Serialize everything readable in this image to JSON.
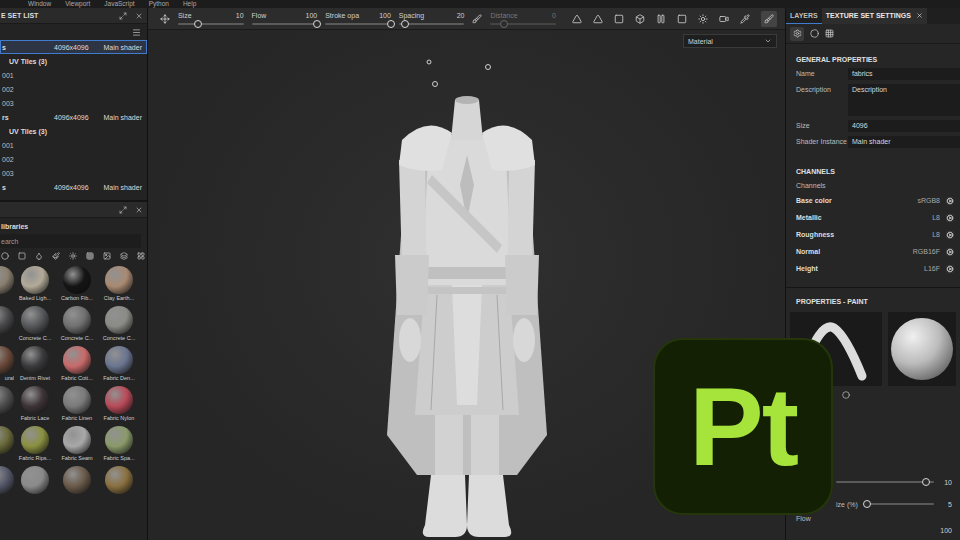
{
  "menu": [
    "Window",
    "Viewport",
    "JavaScript",
    "Python",
    "Help"
  ],
  "toolbar": {
    "sliders": [
      {
        "label": "Size",
        "value": "10",
        "level": 0.3,
        "disabled": false
      },
      {
        "label": "Flow",
        "value": "100",
        "level": 1,
        "disabled": false
      },
      {
        "label": "Stroke opa",
        "value": "100",
        "level": 1,
        "disabled": false
      },
      {
        "label": "Spacing",
        "value": "20",
        "level": 0.1,
        "disabled": false
      },
      {
        "label": "Distance",
        "value": "0",
        "level": 0.2,
        "disabled": true
      }
    ]
  },
  "textureSetList": {
    "title": "E SET LIST",
    "rows": [
      {
        "kind": "set",
        "name": "s",
        "size": "4096x4096",
        "shader": "Main shader",
        "selected": true
      },
      {
        "kind": "group",
        "name": "UV Tiles (3)",
        "selected": false
      },
      {
        "kind": "tile",
        "name": "001",
        "selected": false
      },
      {
        "kind": "tile",
        "name": "002",
        "selected": false
      },
      {
        "kind": "tile",
        "name": "003",
        "selected": false
      },
      {
        "kind": "set",
        "name": "rs",
        "size": "4096x4096",
        "shader": "Main shader",
        "selected": false
      },
      {
        "kind": "group",
        "name": "UV Tiles (3)",
        "selected": false
      },
      {
        "kind": "tile",
        "name": "001",
        "selected": false
      },
      {
        "kind": "tile",
        "name": "002",
        "selected": false
      },
      {
        "kind": "tile",
        "name": "003",
        "selected": false
      },
      {
        "kind": "set",
        "name": "s",
        "size": "4096x4096",
        "shader": "Main shader",
        "selected": false
      }
    ]
  },
  "libraries": {
    "title": "libraries",
    "search": "earch",
    "materials": [
      {
        "cut": true,
        "color": "#8a8070"
      },
      {
        "label": "Baked Ligh...",
        "color": "#b3aa98"
      },
      {
        "label": "Carbon Fib...",
        "color": "#151515"
      },
      {
        "label": "Clay Earth...",
        "color": "#a98a72"
      },
      {
        "cut": true,
        "color": "#4a4a4c"
      },
      {
        "label": "Concrete C...",
        "color": "#56575a"
      },
      {
        "label": "Concrete C...",
        "color": "#707070"
      },
      {
        "label": "Concrete C...",
        "color": "#8a8a86"
      },
      {
        "cut": true,
        "label": "ural",
        "color": "#6b4a3a"
      },
      {
        "label": "Denim Rivet",
        "color": "#3a3a3c"
      },
      {
        "label": "Fabric Cott...",
        "color": "#c86a6a"
      },
      {
        "label": "Fabric Den...",
        "color": "#6a7590"
      },
      {
        "cut": true,
        "color": "#505050"
      },
      {
        "label": "Fabric Lace",
        "color": "#3e3438"
      },
      {
        "label": "Fabric Linen",
        "color": "#7a7a7a"
      },
      {
        "label": "Fabric Nylon",
        "color": "#b84a58"
      },
      {
        "cut": true,
        "color": "#6a6a3a"
      },
      {
        "label": "Fabric Rips...",
        "color": "#8a9040"
      },
      {
        "label": "Fabric Seam",
        "color": "#a8a8a8"
      },
      {
        "label": "Fabric Spa...",
        "color": "#8a9a6a"
      },
      {
        "cut": true,
        "color": "#55586a"
      },
      {
        "color": "#8a8a8a"
      },
      {
        "color": "#6a5a4a"
      },
      {
        "color": "#8a7040"
      }
    ]
  },
  "viewport": {
    "mode": "Material"
  },
  "rightPanel": {
    "tabs": [
      {
        "label": "LAYERS",
        "selected": false
      },
      {
        "label": "TEXTURE SET SETTINGS",
        "selected": true
      }
    ],
    "general": {
      "title": "GENERAL PROPERTIES",
      "fields": [
        {
          "kind": "text",
          "label": "Name",
          "value": "fabrics"
        },
        {
          "kind": "area",
          "label": "Description",
          "value": "Description"
        },
        {
          "kind": "text",
          "label": "Size",
          "value": "4096"
        },
        {
          "kind": "text",
          "label": "Shader Instance",
          "value": "Main shader"
        }
      ]
    },
    "channels": {
      "title": "CHANNELS",
      "subtitle": "Channels",
      "rows": [
        {
          "name": "Base color",
          "format": "sRGB8"
        },
        {
          "name": "Metallic",
          "format": "L8"
        },
        {
          "name": "Roughness",
          "format": "L8"
        },
        {
          "name": "Normal",
          "format": "RGB16F"
        },
        {
          "name": "Height",
          "format": "L16F"
        }
      ]
    },
    "paint": {
      "title": "PROPERTIES - PAINT",
      "controls": [
        {
          "value": "10",
          "level": 0.92
        },
        {
          "label": "ize (%)",
          "value": "5",
          "level": 0.05
        }
      ],
      "footer": "Flow",
      "footerValue": "100"
    }
  },
  "logo": {
    "text": "Pt"
  }
}
